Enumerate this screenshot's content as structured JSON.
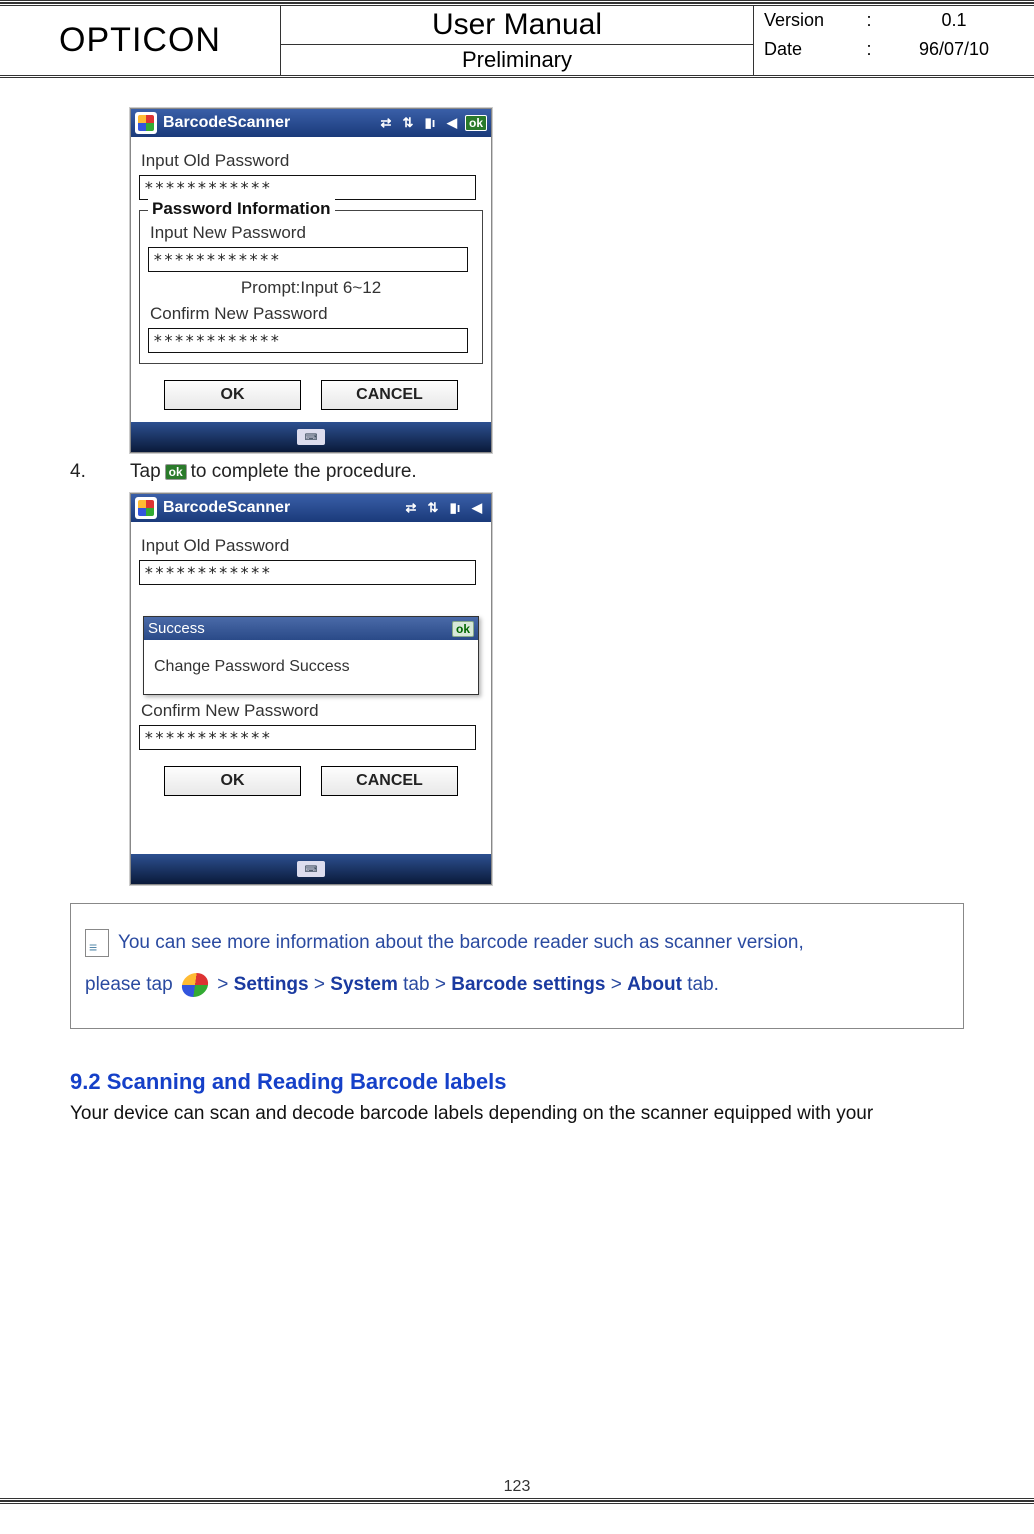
{
  "header": {
    "brand": "OPTICON",
    "title": "User Manual",
    "subtitle": "Preliminary",
    "version_label": "Version",
    "version_sep": ":",
    "version_value": "0.1",
    "date_label": "Date",
    "date_sep": ":",
    "date_value": "96/07/10"
  },
  "screenshot1": {
    "app_title": "BarcodeScanner",
    "ok_label": "ok",
    "label_old": "Input Old Password",
    "value_old": "************",
    "fieldset_legend": "Password Information",
    "label_new": "Input New Password",
    "value_new": "************",
    "prompt": "Prompt:Input 6~12",
    "label_confirm": "Confirm New Password",
    "value_confirm": "************",
    "btn_ok": "OK",
    "btn_cancel": "CANCEL"
  },
  "step4": {
    "num": "4.",
    "text_before": "Tap ",
    "ok_icon_text": "ok",
    "text_after": " to complete the procedure."
  },
  "screenshot2": {
    "app_title": "BarcodeScanner",
    "label_old": "Input Old Password",
    "value_old": "************",
    "label_confirm": "Confirm New Password",
    "value_confirm": "************",
    "popup_title": "Success",
    "popup_ok": "ok",
    "popup_body": "Change Password Success",
    "btn_ok": "OK",
    "btn_cancel": "CANCEL"
  },
  "note": {
    "line1": " You can see more information about the barcode reader such as scanner version,",
    "line2_a": "please tap ",
    "gt": ">",
    "settings": "Settings",
    "system": "System",
    "tab_word": " tab ",
    "barcode": "Barcode settings",
    "about": "About",
    "tab_end": " tab."
  },
  "section": {
    "heading": "9.2 Scanning and Reading Barcode labels",
    "body": "Your device can scan and decode barcode labels depending on the scanner equipped with your"
  },
  "page_number": "123"
}
